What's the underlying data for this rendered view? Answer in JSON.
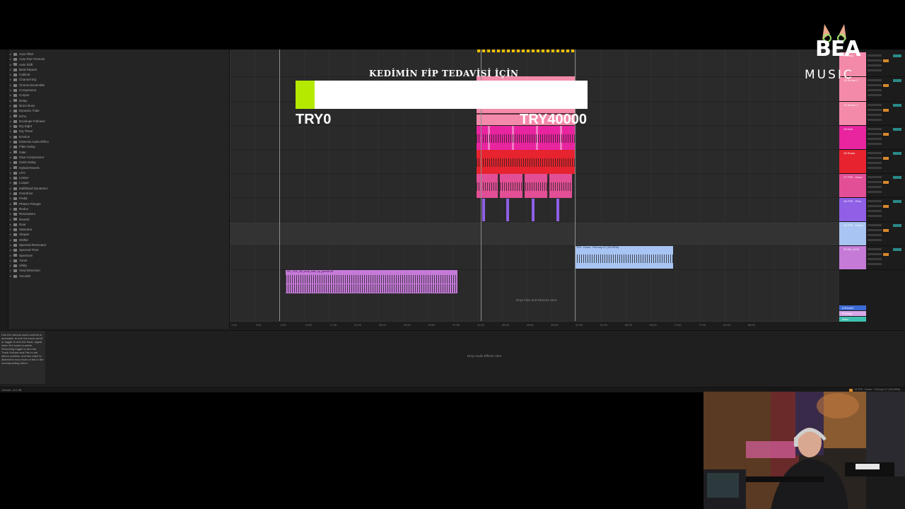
{
  "overlay": {
    "title": "KEDİMİN FİP TEDAVİSİ İÇİN",
    "min_label": "TRY0",
    "max_label": "TRY40000",
    "progress_fraction": 0.065,
    "fill_color": "#b5ea00"
  },
  "logo": {
    "top": "BEA",
    "bottom": "MUSIC"
  },
  "browser": {
    "items": [
      "Auto Filter",
      "Auto Pan-Tremolo",
      "Auto Shift",
      "Beat Repeat",
      "Cabinet",
      "Channel EQ",
      "Chorus-Ensemble",
      "Compressor",
      "Corpus",
      "Delay",
      "Drum Buss",
      "Dynamic Tube",
      "Echo",
      "Envelope Follower",
      "EQ Eight",
      "EQ Three",
      "Erosion",
      "External Audio Effect",
      "Filter Delay",
      "Gate",
      "Glue Compressor",
      "Grain Delay",
      "Hybrid Reverb",
      "LFO",
      "Limiter",
      "Looper",
      "Multiband Dynamics",
      "Overdrive",
      "Pedal",
      "Phaser-Flanger",
      "Redux",
      "Resonators",
      "Reverb",
      "Roar",
      "Saturator",
      "Shaper",
      "Shifter",
      "Spectral Resonator",
      "Spectral Time",
      "Spectrum",
      "Tuner",
      "Utility",
      "Vinyl Distortion",
      "Vocoder"
    ]
  },
  "arrangement": {
    "drop_hint": "Drop Files and Devices Here",
    "ruler_ticks": [
      "1:00",
      "5:00",
      "9:00",
      "13:00",
      "17:00",
      "21:00",
      "25:00",
      "29:00",
      "33:00",
      "37:00",
      "41:00",
      "45:00",
      "49:00",
      "53:00",
      "57:00",
      "61:00",
      "65:00",
      "69:00",
      "73:00",
      "77:00",
      "81:00",
      "85:00"
    ],
    "clip_labels": {
      "vocal": "MX_VOX_1B_vocal_fade_up_gatedfx.aif",
      "fx": "TPE - Drone - Pull loop 07 (120 BPM)"
    }
  },
  "tracks": [
    {
      "name": "6 Group",
      "color": "#f48aa9"
    },
    {
      "name": "13 Serum 2",
      "color": "#f48aa9"
    },
    {
      "name": "13 Serum 2",
      "color": "#f48aa9"
    },
    {
      "name": "15 Kick",
      "color": "#e8249f"
    },
    {
      "name": "16 Snare",
      "color": "#e6232e"
    },
    {
      "name": "17 TPE - Drum",
      "color": "#e24f96"
    },
    {
      "name": "18 TPE - Perc",
      "color": "#8f5fe6"
    },
    {
      "name": "19 TPE - Drone",
      "color": "#a8c4f2"
    },
    {
      "name": "20 MX_VOX",
      "color": "#c57ad8"
    }
  ],
  "returns": [
    {
      "name": "A Reverb",
      "color": "#3d6bd6"
    },
    {
      "name": "B Delay",
      "color": "#d8a8e8"
    },
    {
      "name": "Main",
      "color": "#3ec0b0"
    }
  ],
  "device_panel": {
    "info_text": "Use the various track controls to automate, to turn the track on/off or toggle to arm the track, signal when Sol mode is active. Recording toggle to arm the Track Volume and Pan to set stereo position, and see each to determine how much of the to the corresponding return.",
    "drop_hint": "Drop Audio Effects Here"
  },
  "status": {
    "left": "Volume: -6.0 dB",
    "right": "19-TPE - Drone - Pull loop 07 (120 BPM)"
  }
}
